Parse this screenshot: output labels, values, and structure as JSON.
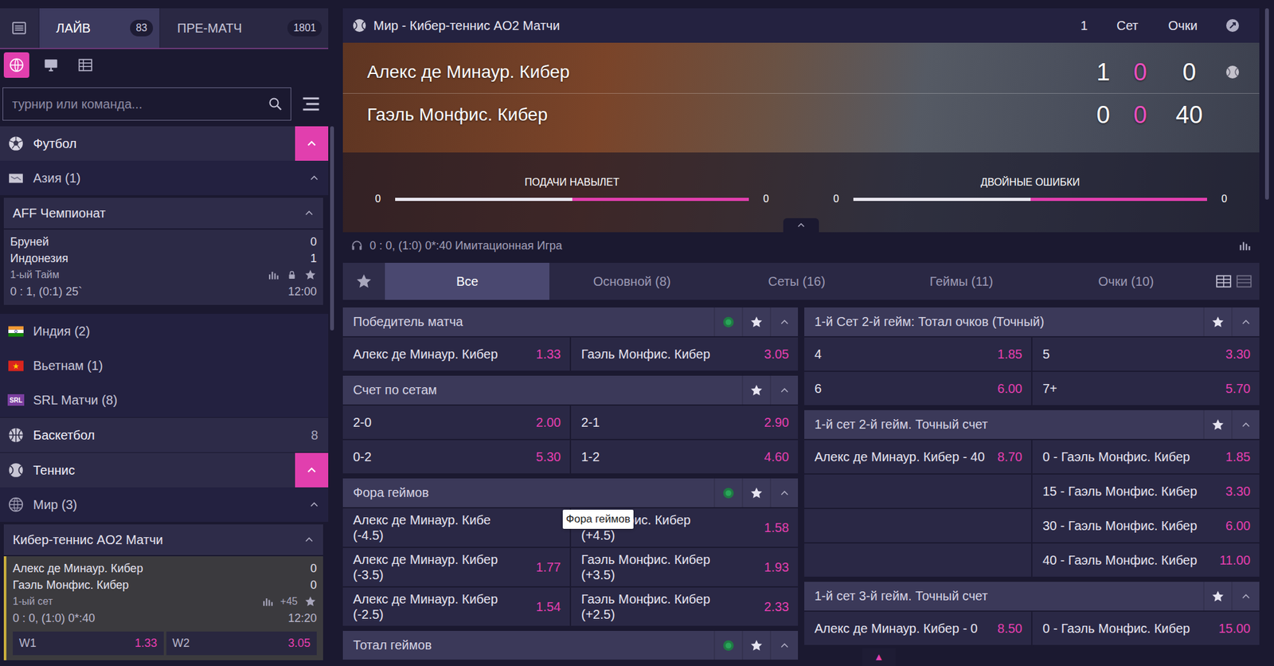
{
  "top_tabs": [
    {
      "label": "ЛАЙВ",
      "count": "83",
      "selected": true
    },
    {
      "label": "ПРЕ-МАТЧ",
      "count": "1801",
      "selected": false
    }
  ],
  "view_modes": [
    {
      "kind": "globe",
      "selected": true
    },
    {
      "kind": "monitor",
      "selected": false
    },
    {
      "kind": "table",
      "selected": false
    }
  ],
  "search": {
    "placeholder": "турнир или команда..."
  },
  "sidebar": {
    "items": [
      {
        "kind": "sport",
        "label": "Футбол",
        "expanded": true
      },
      {
        "kind": "region",
        "label": "Азия (1)",
        "expanded": true
      },
      {
        "kind": "league",
        "label": "AFF Чемпионат",
        "expanded": true
      },
      {
        "kind": "match",
        "selected": false,
        "teams": [
          {
            "name": "Бруней",
            "score": "0"
          },
          {
            "name": "Индонезия",
            "score": "1"
          }
        ],
        "period": "1-ый Тайм",
        "locked": true,
        "detail": "0 : 1, (0:1) 25`",
        "time": "12:00"
      },
      {
        "kind": "region",
        "label": "Индия (2)",
        "expanded": false
      },
      {
        "kind": "region",
        "label": "Вьетнам (1)",
        "expanded": false
      },
      {
        "kind": "region",
        "label": "SRL Матчи (8)",
        "logo": "SRL",
        "expanded": false
      },
      {
        "kind": "sport",
        "label": "Баскетбол",
        "count": "8",
        "expanded": false
      },
      {
        "kind": "sport",
        "label": "Теннис",
        "expanded": true
      },
      {
        "kind": "region",
        "label": "Мир (3)",
        "expanded": true
      },
      {
        "kind": "league",
        "label": "Кибер-теннис AO2 Матчи",
        "expanded": true
      },
      {
        "kind": "match",
        "selected": true,
        "teams": [
          {
            "name": "Алекс де Минаур. Кибер",
            "score": "0"
          },
          {
            "name": "Гаэль Монфис. Кибер",
            "score": "0"
          }
        ],
        "period": "1-ый сет",
        "locked": false,
        "markets": "+45",
        "detail": "0 : 0, (1:0) 0*:40",
        "time": "12:20",
        "odds": [
          {
            "label": "W1",
            "value": "1.33"
          },
          {
            "label": "W2",
            "value": "3.05"
          }
        ]
      }
    ]
  },
  "event": {
    "title": "Мир - Кибер-теннис AO2 Матчи",
    "columns": [
      "1",
      "Сет",
      "Очки"
    ],
    "players": [
      {
        "name": "Алекс де Минаур. Кибер",
        "scores": [
          "1",
          "0",
          "0"
        ],
        "serving": true
      },
      {
        "name": "Гаэль Монфис. Кибер",
        "scores": [
          "0",
          "0",
          "40"
        ],
        "serving": false
      }
    ],
    "stats": [
      {
        "label": "ПОДАЧИ НАВЫЛЕТ",
        "left": "0",
        "right": "0",
        "level": 0.5
      },
      {
        "label": "ДВОЙНЫЕ ОШИБКИ",
        "left": "0",
        "right": "0",
        "level": 0.5
      }
    ],
    "info": "0 : 0, (1:0) 0*:40 Имитационная Игра"
  },
  "market_tabs": [
    {
      "label": "Все",
      "selected": true
    },
    {
      "label": "Основной (8)",
      "selected": false
    },
    {
      "label": "Сеты (16)",
      "selected": false
    },
    {
      "label": "Геймы (11)",
      "selected": false
    },
    {
      "label": "Очки (10)",
      "selected": false
    }
  ],
  "layout_modes": [
    {
      "kind": "grid",
      "selected": true
    },
    {
      "kind": "list",
      "selected": false
    }
  ],
  "markets": {
    "left": [
      {
        "title": "Победитель матча",
        "live": true,
        "expanded": true,
        "rows": [
          [
            {
              "label": "Алекс де Минаур. Кибер",
              "odds": "1.33"
            },
            {
              "label": "Гаэль Монфис. Кибер",
              "odds": "3.05"
            }
          ]
        ]
      },
      {
        "title": "Счет по сетам",
        "live": false,
        "expanded": true,
        "rows": [
          [
            {
              "label": "2-0",
              "odds": "2.00"
            },
            {
              "label": "2-1",
              "odds": "2.90"
            }
          ],
          [
            {
              "label": "0-2",
              "odds": "5.30"
            },
            {
              "label": "1-2",
              "odds": "4.60"
            }
          ]
        ]
      },
      {
        "title": "Фора геймов",
        "live": true,
        "expanded": true,
        "tooltip": "Фора геймов",
        "rows": [
          [
            {
              "label": "Алекс де Минаур. Кибе",
              "sub": "(-4.5)"
            },
            {
              "label": "ль Монфис. Кибер",
              "sub": "(+4.5)",
              "odds": "1.58"
            }
          ],
          [
            {
              "label": "Алекс де Минаур. Кибер",
              "sub": "(-3.5)",
              "odds": "1.77"
            },
            {
              "label": "Гаэль Монфис. Кибер",
              "sub": "(+3.5)",
              "odds": "1.93"
            }
          ],
          [
            {
              "label": "Алекс де Минаур. Кибер",
              "sub": "(-2.5)",
              "odds": "1.54"
            },
            {
              "label": "Гаэль Монфис. Кибер",
              "sub": "(+2.5)",
              "odds": "2.33"
            }
          ]
        ]
      },
      {
        "title": "Тотал геймов",
        "live": true,
        "expanded": true,
        "rows": []
      }
    ],
    "right": [
      {
        "title": "1-й Сет 2-й гейм: Тотал очков (Точный)",
        "live": false,
        "expanded": true,
        "rows": [
          [
            {
              "label": "4",
              "odds": "1.85"
            },
            {
              "label": "5",
              "odds": "3.30"
            }
          ],
          [
            {
              "label": "6",
              "odds": "6.00"
            },
            {
              "label": "7+",
              "odds": "5.70"
            }
          ]
        ]
      },
      {
        "title": "1-й сет 2-й гейм. Точный счет",
        "live": false,
        "expanded": true,
        "rows": [
          [
            {
              "label": "Алекс де Минаур. Кибер - 40",
              "odds": "8.70"
            },
            {
              "label": "0 - Гаэль Монфис. Кибер",
              "odds": "1.85"
            }
          ],
          [
            {},
            {
              "label": "15 - Гаэль Монфис. Кибер",
              "odds": "3.30"
            }
          ],
          [
            {},
            {
              "label": "30 - Гаэль Монфис. Кибер",
              "odds": "6.00"
            }
          ],
          [
            {},
            {
              "label": "40 - Гаэль Монфис. Кибер",
              "odds": "11.00"
            }
          ]
        ]
      },
      {
        "title": "1-й сет 3-й гейм. Точный счет",
        "live": false,
        "expanded": true,
        "rows": [
          [
            {
              "label": "Алекс де Минаур. Кибер - 0",
              "odds": "8.50"
            },
            {
              "label": "0 - Гаэль Монфис. Кибер",
              "odds": "15.00"
            }
          ]
        ]
      }
    ]
  },
  "scroll_top": "▲"
}
